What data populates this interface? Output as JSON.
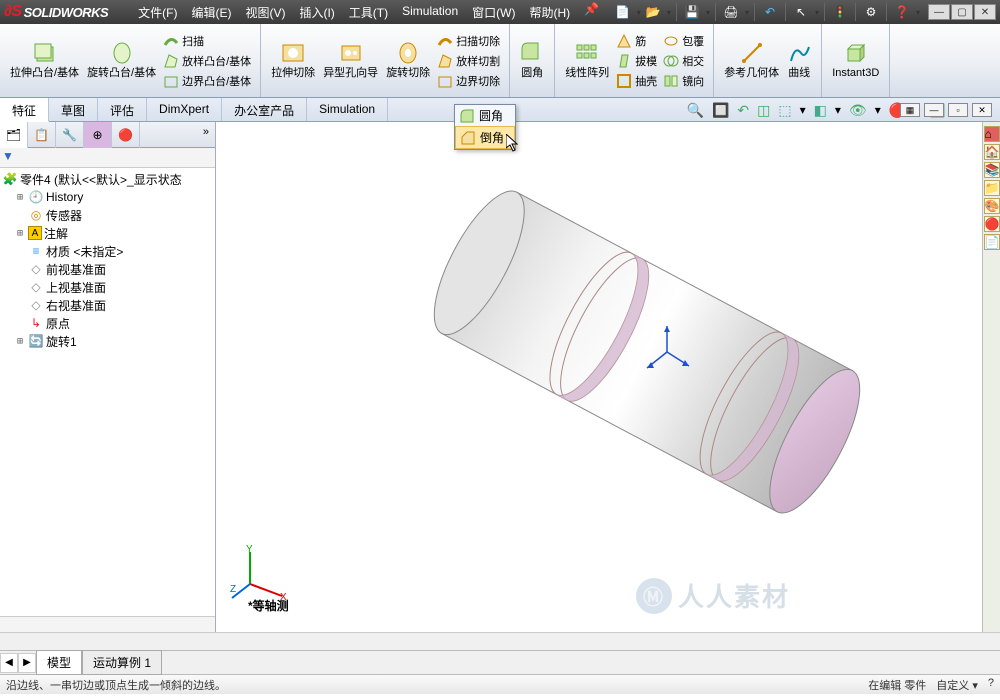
{
  "app": {
    "brand": "SOLIDWORKS"
  },
  "menus": [
    "文件(F)",
    "编辑(E)",
    "视图(V)",
    "插入(I)",
    "工具(T)",
    "Simulation",
    "窗口(W)",
    "帮助(H)"
  ],
  "ribbon": {
    "extrude_boss": "拉伸凸台/基体",
    "revolve_boss": "旋转凸台/基体",
    "sweep": "扫描",
    "loft": "放样凸台/基体",
    "boundary": "边界凸台/基体",
    "extrude_cut": "拉伸切除",
    "hole_wizard": "异型孔向导",
    "revolve_cut": "旋转切除",
    "sweep_cut": "扫描切除",
    "loft_cut": "放样切割",
    "boundary_cut": "边界切除",
    "fillet": "圆角",
    "linear_pattern": "线性阵列",
    "rib": "筋",
    "draft": "拔模",
    "shell": "抽壳",
    "wrap": "包覆",
    "intersect": "相交",
    "mirror": "镜向",
    "ref_geom": "参考几何体",
    "curve": "曲线",
    "instant3d": "Instant3D"
  },
  "tabs": [
    "特征",
    "草图",
    "评估",
    "DimXpert",
    "办公室产品",
    "Simulation"
  ],
  "tree": {
    "root": "零件4  (默认<<默认>_显示状态",
    "history": "History",
    "sensors": "传感器",
    "annotations": "注解",
    "material": "材质 <未指定>",
    "front": "前视基准面",
    "top": "上视基准面",
    "right": "右视基准面",
    "origin": "原点",
    "revolve1": "旋转1"
  },
  "popup": {
    "fillet": "圆角",
    "chamfer": "倒角"
  },
  "bottombar": {
    "model": "模型",
    "study": "运动算例 1",
    "star": "*",
    "view_label": "等轴测"
  },
  "statusbar": {
    "hint": "沿边线、一串切边或顶点生成一倾斜的边线。",
    "mode": "在编辑 零件",
    "custom": "自定义",
    "help": "?"
  },
  "colors": {
    "accent": "#e61e26",
    "brand_bg": "#3a3a3a"
  }
}
